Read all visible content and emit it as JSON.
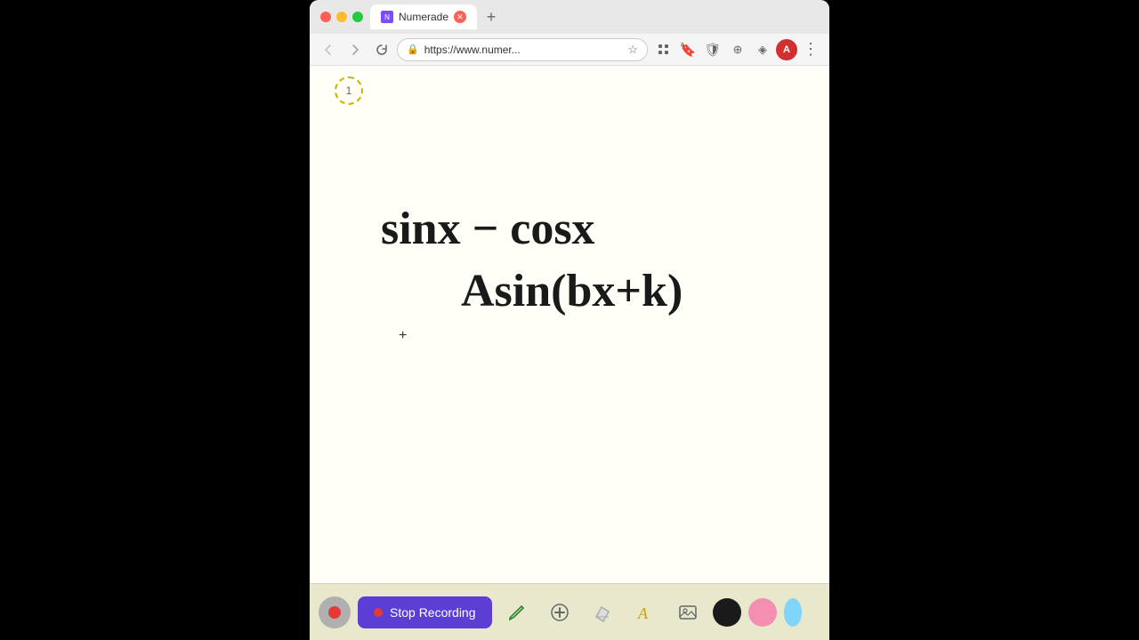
{
  "browser": {
    "tab_title": "Numerade",
    "url": "https://www.numer...",
    "tab_new_label": "+",
    "nav": {
      "back_title": "←",
      "forward_title": "→",
      "refresh_title": "↻",
      "more_title": "⋮"
    },
    "profile_initial": "A"
  },
  "page": {
    "number": "1",
    "math_line1": "sinx − cosx",
    "math_line2": "Asin(bx+k)"
  },
  "toolbar": {
    "stop_recording_label": "Stop Recording",
    "colors": {
      "black": "#1a1a1a",
      "pink": "#f48fb1"
    }
  }
}
